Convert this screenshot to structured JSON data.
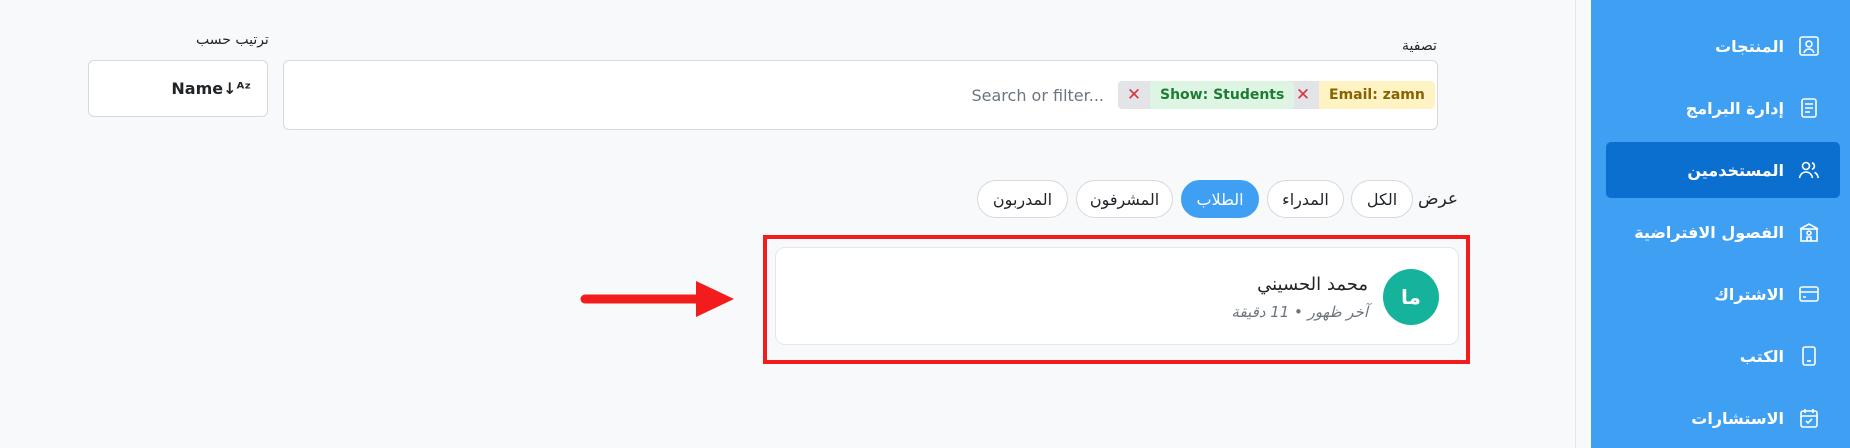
{
  "sidebar": {
    "items": [
      {
        "label": "المنتجات",
        "icon": "portrait-icon",
        "active": false
      },
      {
        "label": "إدارة البرامج",
        "icon": "list-document-icon",
        "active": false
      },
      {
        "label": "المستخدمين",
        "icon": "users-icon",
        "active": true
      },
      {
        "label": "الفصول الافتراضية",
        "icon": "classroom-building-icon",
        "active": false
      },
      {
        "label": "الاشتراك",
        "icon": "credit-card-icon",
        "active": false
      },
      {
        "label": "الكتب",
        "icon": "book-icon",
        "active": false
      },
      {
        "label": "الاستشارات",
        "icon": "calendar-check-icon",
        "active": false
      }
    ],
    "background": "#3f9ff3",
    "active_background": "#0b6fd0"
  },
  "filter": {
    "label": "تصفية",
    "chips": [
      {
        "text": "Email: zamn",
        "color": "#fff3c4",
        "text_color": "#856404"
      },
      {
        "text": "Show: Students",
        "color": "#def5e4",
        "text_color": "#1e7b34"
      }
    ],
    "search_placeholder": "Search or filter..."
  },
  "sort": {
    "label": "ترتيب حسب",
    "value": "Name↓ᴬᶻ"
  },
  "view": {
    "label": "عرض",
    "options": [
      {
        "label": "الكل",
        "active": false
      },
      {
        "label": "المدراء",
        "active": false
      },
      {
        "label": "الطلاب",
        "active": true
      },
      {
        "label": "المشرفون",
        "active": false
      },
      {
        "label": "المدربون",
        "active": false
      }
    ]
  },
  "user": {
    "initials": "ما",
    "name": "محمد الحسيني",
    "last_seen": "آخر ظهور • 11 دقيقة",
    "avatar_color": "#15b39c"
  },
  "annotation": {
    "highlight_color": "#f21c1c"
  }
}
